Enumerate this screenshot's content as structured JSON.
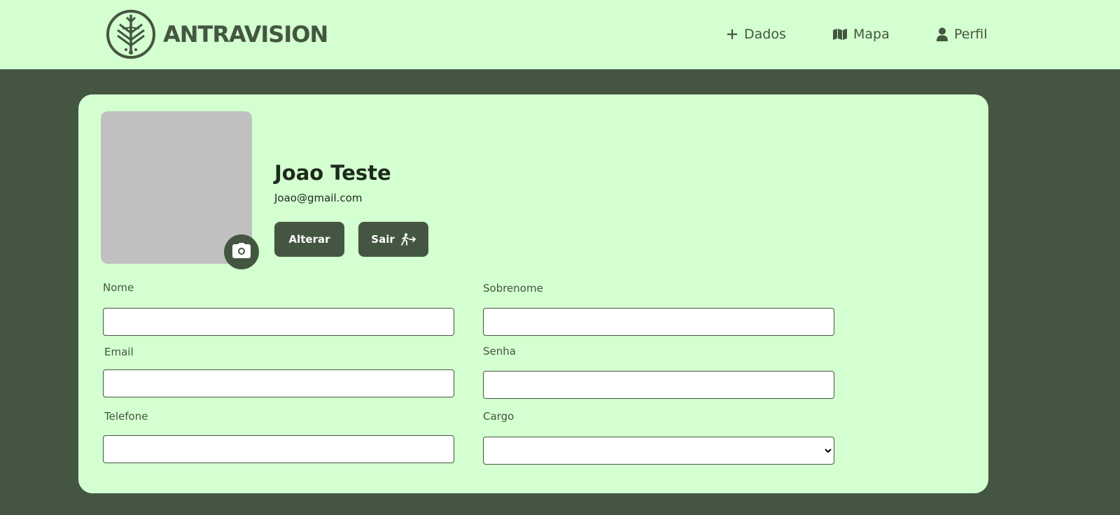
{
  "brand": {
    "name": "ANTRAVISION"
  },
  "nav": {
    "dados": "Dados",
    "mapa": "Mapa",
    "perfil": "Perfil"
  },
  "profile": {
    "name": "Joao Teste",
    "email": "Joao@gmail.com",
    "alterar_label": "Alterar",
    "sair_label": "Sair"
  },
  "form": {
    "nome_label": "Nome",
    "nome_value": "",
    "sobrenome_label": "Sobrenome",
    "sobrenome_value": "",
    "email_label": "Email",
    "email_value": "",
    "senha_label": "Senha",
    "senha_value": "",
    "telefone_label": "Telefone",
    "telefone_value": "",
    "cargo_label": "Cargo",
    "cargo_value": ""
  },
  "colors": {
    "background_dark": "#445641",
    "background_light": "#d4ffd0",
    "photo_placeholder": "#c0c0c0",
    "text_dark": "#1c2a1c"
  },
  "icons": {
    "logo": "palm-leaf-logo-icon",
    "dados": "plus-icon",
    "mapa": "map-icon",
    "perfil": "user-icon",
    "sair": "exit-icon",
    "camera": "camera-icon"
  }
}
